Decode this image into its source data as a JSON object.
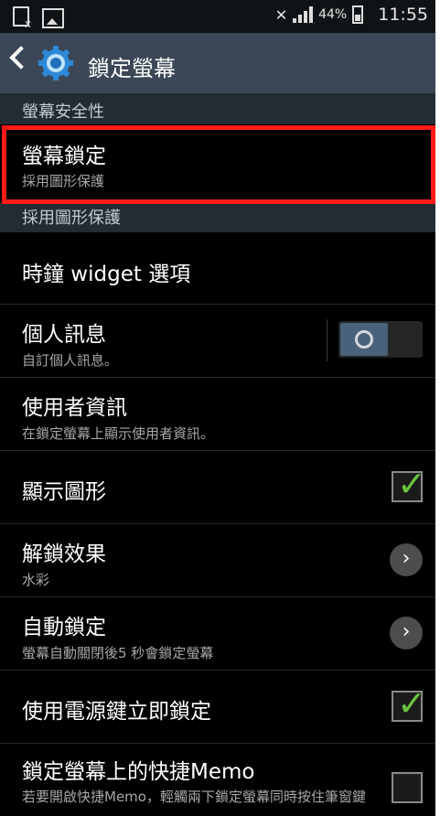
{
  "status": {
    "battery_pct": "44%",
    "time": "11:55",
    "icons": [
      "screenshot-icon",
      "image-icon",
      "mute-icon",
      "signal-icon",
      "battery-icon"
    ]
  },
  "actionbar": {
    "title": "鎖定螢幕",
    "icon": "gear-icon"
  },
  "sections": {
    "screen_security": "螢幕安全性",
    "pattern_header": "採用圖形保護"
  },
  "items": {
    "screen_lock": {
      "title": "螢幕鎖定",
      "subtitle": "採用圖形保護"
    },
    "clock_widget": {
      "title": "時鐘 widget 選項"
    },
    "personal_info": {
      "title": "個人訊息",
      "subtitle": "自訂個人訊息。",
      "toggle": "off"
    },
    "user_info": {
      "title": "使用者資訊",
      "subtitle": "在鎖定螢幕上顯示使用者資訊。"
    },
    "show_pattern": {
      "title": "顯示圖形",
      "checked": true
    },
    "unlock_effect": {
      "title": "解鎖效果",
      "subtitle": "水彩"
    },
    "auto_lock": {
      "title": "自動鎖定",
      "subtitle": "螢幕自動關閉後5 秒會鎖定螢幕"
    },
    "power_lock": {
      "title": "使用電源鍵立即鎖定",
      "checked": true
    },
    "quick_memo": {
      "title": "鎖定螢幕上的快捷Memo",
      "subtitle": "若要開啟快捷Memo，輕觸兩下鎖定螢幕同時按住筆窗鍵",
      "checked": false
    }
  },
  "colors": {
    "highlight": "#ff1a1a",
    "check": "#69c33b",
    "actionbar": "#3b4756"
  }
}
